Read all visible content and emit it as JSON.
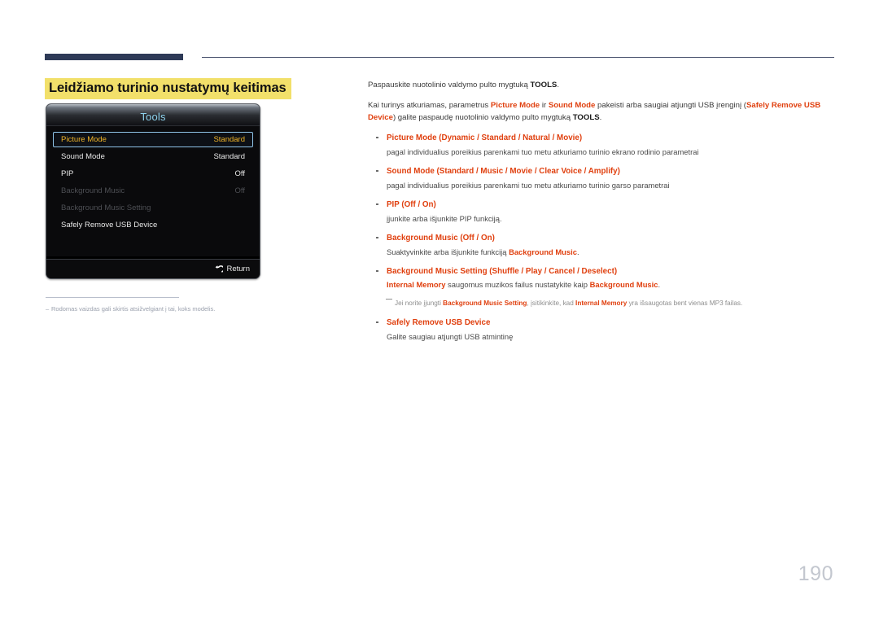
{
  "page": {
    "number": "190"
  },
  "header": {
    "title": "Leidžiamo turinio nustatymų keitimas"
  },
  "osd": {
    "title": "Tools",
    "rows": [
      {
        "label": "Picture Mode",
        "value": "Standard",
        "state": "selected"
      },
      {
        "label": "Sound Mode",
        "value": "Standard",
        "state": "normal"
      },
      {
        "label": "PIP",
        "value": "Off",
        "state": "normal"
      },
      {
        "label": "Background Music",
        "value": "Off",
        "state": "disabled"
      },
      {
        "label": "Background Music Setting",
        "value": "",
        "state": "disabled"
      },
      {
        "label": "Safely Remove USB Device",
        "value": "",
        "state": "normal"
      }
    ],
    "return_label": "Return",
    "return_icon": "return-arrow-icon",
    "colors": {
      "selected_text": "#f0b429",
      "selected_border": "#8fc4e8",
      "title_text": "#8fd4ef",
      "disabled_text": "#4d4f54"
    }
  },
  "left_note": {
    "dash": "–",
    "text": "Rodomas vaizdas gali skirtis atsižvelgiant į tai, koks modelis."
  },
  "body": {
    "intro1_pre": "Paspauskite nuotolinio valdymo pulto mygtuką ",
    "intro1_bold": "TOOLS",
    "intro1_post": ".",
    "intro2_a": "Kai turinys atkuriamas, parametrus ",
    "intro2_b": "Picture Mode",
    "intro2_c": " ir ",
    "intro2_d": "Sound Mode",
    "intro2_e": " pakeisti arba saugiai atjungti USB įrenginį (",
    "intro2_f": "Safely Remove USB Device",
    "intro2_g": ") galite paspaudę nuotolinio valdymo pulto mygtuką ",
    "intro2_h": "TOOLS",
    "intro2_i": "."
  },
  "bullets": [
    {
      "name": "Picture Mode",
      "options": "(Dynamic / Standard / Natural / Movie)",
      "desc": "pagal individualius poreikius parenkami tuo metu atkuriamo turinio ekrano rodinio parametrai"
    },
    {
      "name": "Sound Mode",
      "options": "(Standard / Music / Movie / Clear Voice / Amplify)",
      "desc": "pagal individualius poreikius parenkami tuo metu atkuriamo turinio garso parametrai"
    },
    {
      "name": "PIP",
      "options": "(Off / On)",
      "desc": "įjunkite arba išjunkite PIP funkciją."
    },
    {
      "name": "Background Music",
      "options": "(Off / On)",
      "desc_pre": "Suaktyvinkite arba išjunkite funkciją ",
      "desc_bold": "Background Music",
      "desc_post": "."
    },
    {
      "name": "Background Music Setting",
      "options": "(Shuffle / Play / Cancel / Deselect)",
      "desc_bold1": "Internal Memory",
      "desc_mid": " saugomus muzikos failus nustatykite kaip ",
      "desc_bold2": "Background Music",
      "desc_post": "."
    },
    {
      "name": "Safely Remove USB Device",
      "options": "",
      "desc": "Galite saugiau atjungti USB atmintinę"
    }
  ],
  "inline_note": {
    "pre": "Jei norite įjungti ",
    "bold1": "Background Music Setting",
    "mid": ", įsitikinkite, kad ",
    "bold2": "Internal Memory",
    "post": " yra išsaugotas bent vienas MP3 failas."
  }
}
